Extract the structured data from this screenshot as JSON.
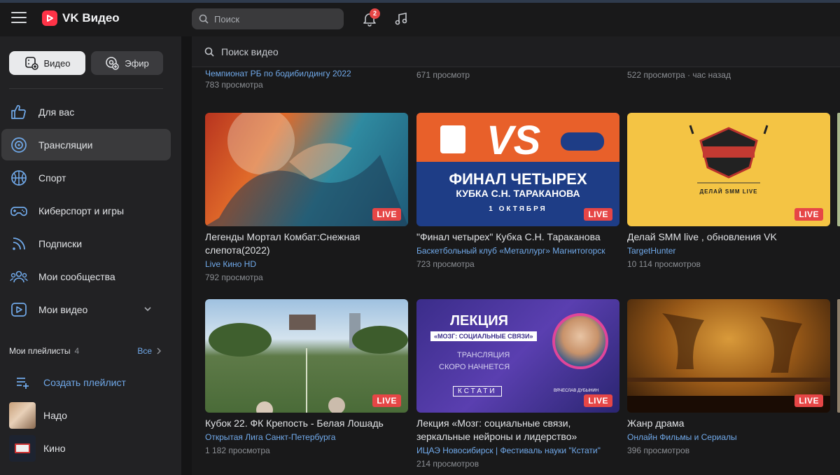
{
  "app": {
    "title": "VK Видео",
    "brand_color": "#ff3347",
    "accent": "#71aaeb"
  },
  "header": {
    "search_placeholder": "Поиск",
    "notifications_count": "2"
  },
  "sidebar": {
    "tabs": [
      {
        "label": "Видео"
      },
      {
        "label": "Эфир"
      }
    ],
    "items": [
      {
        "label": "Для вас",
        "icon": "thumbs-up-icon"
      },
      {
        "label": "Трансляции",
        "icon": "broadcast-icon"
      },
      {
        "label": "Спорт",
        "icon": "basketball-icon"
      },
      {
        "label": "Киберспорт и игры",
        "icon": "gamepad-icon"
      },
      {
        "label": "Подписки",
        "icon": "rss-icon"
      },
      {
        "label": "Мои сообщества",
        "icon": "users-icon"
      },
      {
        "label": "Мои видео",
        "icon": "video-icon"
      }
    ],
    "playlists": {
      "heading": "Мои плейлисты",
      "count": "4",
      "all_label": "Все",
      "create_label": "Создать плейлист",
      "items": [
        {
          "label": "Надо"
        },
        {
          "label": "Кино"
        }
      ]
    }
  },
  "main": {
    "search_placeholder": "Поиск видео",
    "top_row": [
      {
        "channel": "Чемпионат РБ по бодибилдингу 2022",
        "meta": "783 просмотра"
      },
      {
        "channel": "",
        "meta": "671 просмотр"
      },
      {
        "channel": "",
        "meta": "522 просмотра · час назад"
      }
    ],
    "live_label": "LIVE",
    "cards": [
      {
        "title": "Легенды Мортал Комбат:Снежная слепота(2022)",
        "channel": "Live Кино HD",
        "views": "792 просмотра"
      },
      {
        "title": "\"Финал четырех\" Кубка С.Н. Тараканова",
        "channel": "Баскетбольный клуб «Металлург» Магнитогорск",
        "views": "723 просмотра"
      },
      {
        "title": "Делай SMM live , обновления VK",
        "channel": "TargetHunter",
        "views": "10 114 просмотров"
      },
      {
        "title": "Кубок 22. ФК Крепость - Белая Лошадь",
        "channel": "Открытая Лига Санкт-Петербурга",
        "views": "1 182 просмотра"
      },
      {
        "title": "Лекция «Мозг: социальные связи, зеркальные нейроны и лидерство»",
        "channel": "ИЦАЭ Новосибирск | Фестиваль науки \"Кстати\"",
        "views": "214 просмотров"
      },
      {
        "title": "Жанр драма",
        "channel": "Онлайн Фильмы и Сериалы",
        "views": "396 просмотров"
      }
    ],
    "thumb_text": {
      "vs": "VS",
      "final_line1": "ФИНАЛ ЧЕТЫРЕХ",
      "final_line2": "КУБКА С.Н. ТАРАКАНОВА",
      "final_date": "1 ОКТЯБРЯ",
      "smm_line": "ДЕЛАЙ SMM LIVE",
      "lecture_title": "ЛЕКЦИЯ",
      "lecture_sub": "«МОЗГ: СОЦИАЛЬНЫЕ СВЯЗИ»",
      "lecture_soon1": "ТРАНСЛЯЦИЯ",
      "lecture_soon2": "СКОРО НАЧНЕТСЯ",
      "lecture_logo": "КСТАТИ",
      "lecture_person": "ВЯЧЕСЛАВ ДУБЫНИН"
    }
  }
}
